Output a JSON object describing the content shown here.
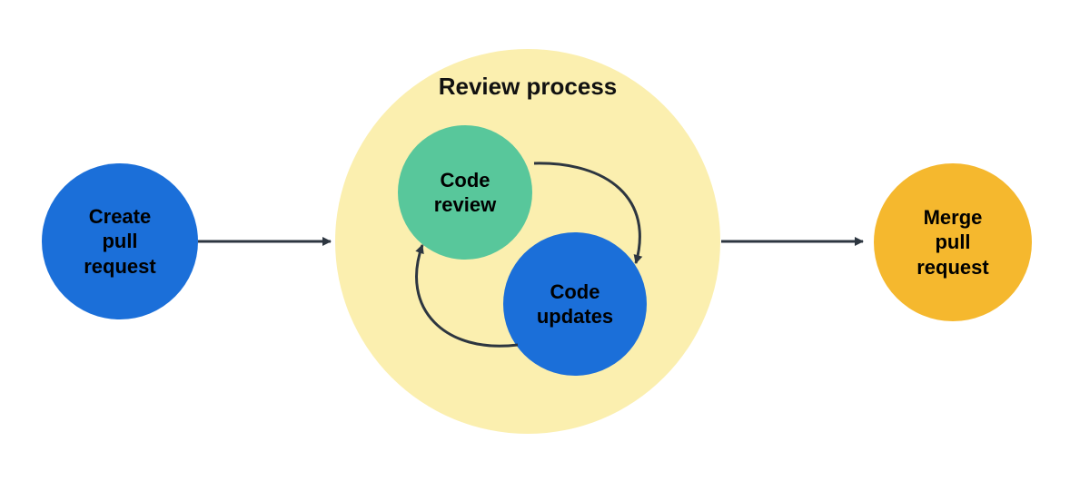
{
  "diagram": {
    "title": "Review process",
    "nodes": {
      "create": "Create\npull\nrequest",
      "review": "Code\nreview",
      "updates": "Code\nupdates",
      "merge": "Merge\npull\nrequest"
    },
    "colors": {
      "blue": "#1b6fd9",
      "green": "#58c79b",
      "cream": "#fbefaf",
      "yellow": "#f5b82e",
      "arrow": "#2d3640"
    }
  }
}
